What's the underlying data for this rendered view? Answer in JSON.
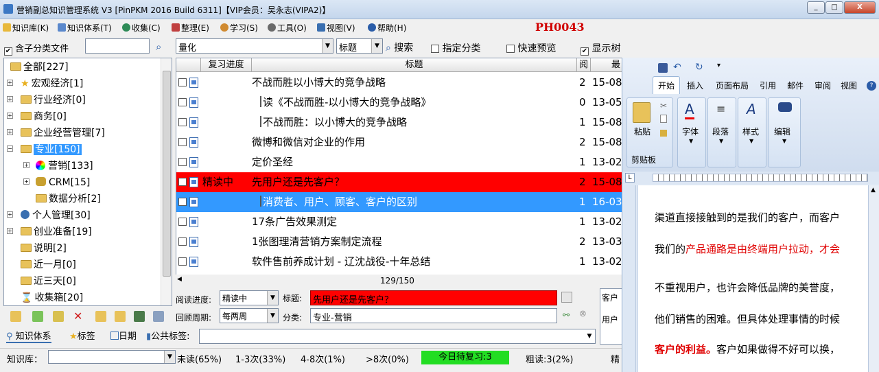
{
  "window": {
    "title": "营销副总知识管理系统 V3 [PinPKM 2016 Build 6311]【VIP会员：吴永志(VIPA2)】",
    "min": "_",
    "max": "□",
    "close": "X"
  },
  "menu": [
    {
      "label": "知识库(K)",
      "icon": "library-icon"
    },
    {
      "label": "知识体系(T)",
      "icon": "hierarchy-icon"
    },
    {
      "label": "收集(C)",
      "icon": "globe-icon"
    },
    {
      "label": "整理(E)",
      "icon": "edit-icon"
    },
    {
      "label": "学习(S)",
      "icon": "person-icon"
    },
    {
      "label": "工具(O)",
      "icon": "gear-icon"
    },
    {
      "label": "视图(V)",
      "icon": "view-icon"
    },
    {
      "label": "帮助(H)",
      "icon": "help-icon"
    }
  ],
  "code_label": "PH0043",
  "filter": {
    "include_sub_label": "含子分类文件",
    "search_text": "",
    "keyword": "量化",
    "field": "标题",
    "search_button": "搜索",
    "specified_category": "指定分类",
    "quick_preview": "快速预览",
    "show_tree": "显示树"
  },
  "tree": [
    {
      "label": "全部[227]",
      "level": 0,
      "expand": false
    },
    {
      "label": "宏观经济[1]",
      "level": 0,
      "expand": true
    },
    {
      "label": "行业经济[0]",
      "level": 0,
      "expand": true
    },
    {
      "label": "商务[0]",
      "level": 0,
      "expand": true
    },
    {
      "label": "企业经营管理[7]",
      "level": 0,
      "expand": true
    },
    {
      "label": "专业[150]",
      "level": 0,
      "expand": true,
      "selected": true
    },
    {
      "label": "营销[133]",
      "level": 1,
      "expand": true
    },
    {
      "label": "CRM[15]",
      "level": 1,
      "expand": true
    },
    {
      "label": "数据分析[2]",
      "level": 1,
      "expand": false
    },
    {
      "label": "个人管理[30]",
      "level": 0,
      "expand": true
    },
    {
      "label": "创业准备[19]",
      "level": 0,
      "expand": true
    },
    {
      "label": "说明[2]",
      "level": 0,
      "expand": false
    },
    {
      "label": "近一月[0]",
      "level": 0,
      "expand": false
    },
    {
      "label": "近三天[0]",
      "level": 0,
      "expand": false
    },
    {
      "label": "收集箱[20]",
      "level": 0,
      "expand": false
    }
  ],
  "grid": {
    "headers": [
      "复习进度",
      "标题",
      "阅",
      "最"
    ],
    "rows": [
      {
        "progress": "",
        "title": "不战而胜以小博大的竞争战略",
        "reads": "2",
        "date": "15-08",
        "indent": false,
        "style": "normal"
      },
      {
        "progress": "",
        "title": "读《不战而胜-以小博大的竞争战略》",
        "reads": "0",
        "date": "13-05",
        "indent": true,
        "style": "normal"
      },
      {
        "progress": "",
        "title": "不战而胜：以小博大的竞争战略",
        "reads": "1",
        "date": "15-08",
        "indent": true,
        "style": "normal"
      },
      {
        "progress": "",
        "title": "微博和微信对企业的作用",
        "reads": "2",
        "date": "15-08",
        "indent": false,
        "style": "normal"
      },
      {
        "progress": "",
        "title": "定价圣经",
        "reads": "1",
        "date": "13-02",
        "indent": false,
        "style": "normal"
      },
      {
        "progress": "精读中",
        "title": "先用户还是先客户？",
        "reads": "2",
        "date": "15-08",
        "indent": false,
        "style": "red"
      },
      {
        "progress": "",
        "title": "消费者、用户、顾客、客户的区别",
        "reads": "1",
        "date": "16-03",
        "indent": true,
        "style": "selected"
      },
      {
        "progress": "",
        "title": "17条广告效果测定",
        "reads": "1",
        "date": "13-02",
        "indent": false,
        "style": "normal"
      },
      {
        "progress": "",
        "title": "1张图理清营销方案制定流程",
        "reads": "2",
        "date": "13-03",
        "indent": false,
        "style": "normal"
      },
      {
        "progress": "",
        "title": "软件售前养成计划 - 辽沈战役-十年总结",
        "reads": "1",
        "date": "13-02",
        "indent": false,
        "style": "normal"
      }
    ],
    "pager": "129/150"
  },
  "props": {
    "read_progress_label": "阅读进度:",
    "read_progress": "精读中",
    "title_label": "标题:",
    "title_value": "先用户还是先客户？",
    "cycle_label": "回顾周期:",
    "cycle": "每两周",
    "category_label": "分类:",
    "category": "专业-营销",
    "customer_label": "客户",
    "user_label": "用户",
    "public_tag_label": "公共标签:",
    "public_tag": ""
  },
  "tabs": [
    "知识体系",
    "标签",
    "日期"
  ],
  "status": {
    "kb_label": "知识库：",
    "kb_value": "",
    "unread": "未读(65%)",
    "r13": "1-3次(33%)",
    "r48": "4-8次(1%)",
    "r8": ">8次(0%)",
    "today_review": "今日待复习:3",
    "rough": "粗读:3(2%)",
    "more": "精"
  },
  "word": {
    "tabs": [
      "开始",
      "插入",
      "页面布局",
      "引用",
      "邮件",
      "审阅",
      "视图"
    ],
    "groups": [
      {
        "label": "剪贴板",
        "button": "粘贴"
      },
      {
        "label": "字体",
        "button": "字体"
      },
      {
        "label": "段落",
        "button": "段落"
      },
      {
        "label": "样式",
        "button": "样式"
      },
      {
        "label": "编辑",
        "button": "编辑"
      }
    ],
    "paras": [
      {
        "text": "渠道直接接触到的是我们的客户，而客户"
      },
      {
        "text": "我们的",
        "red": "产品通路是由终端用户拉动，才会"
      },
      {
        "text": "不重视用户，也许会降低品牌的美誉度，"
      },
      {
        "text": "他们销售的困难。但具体处理事情的时候"
      },
      {
        "bold_red": "客户的利益。",
        "text": "客户如果做得不好可以换，"
      }
    ]
  },
  "colors": {
    "red_row": "#ff0000",
    "selected_row": "#3399ff",
    "status_green": "#22dd22"
  }
}
